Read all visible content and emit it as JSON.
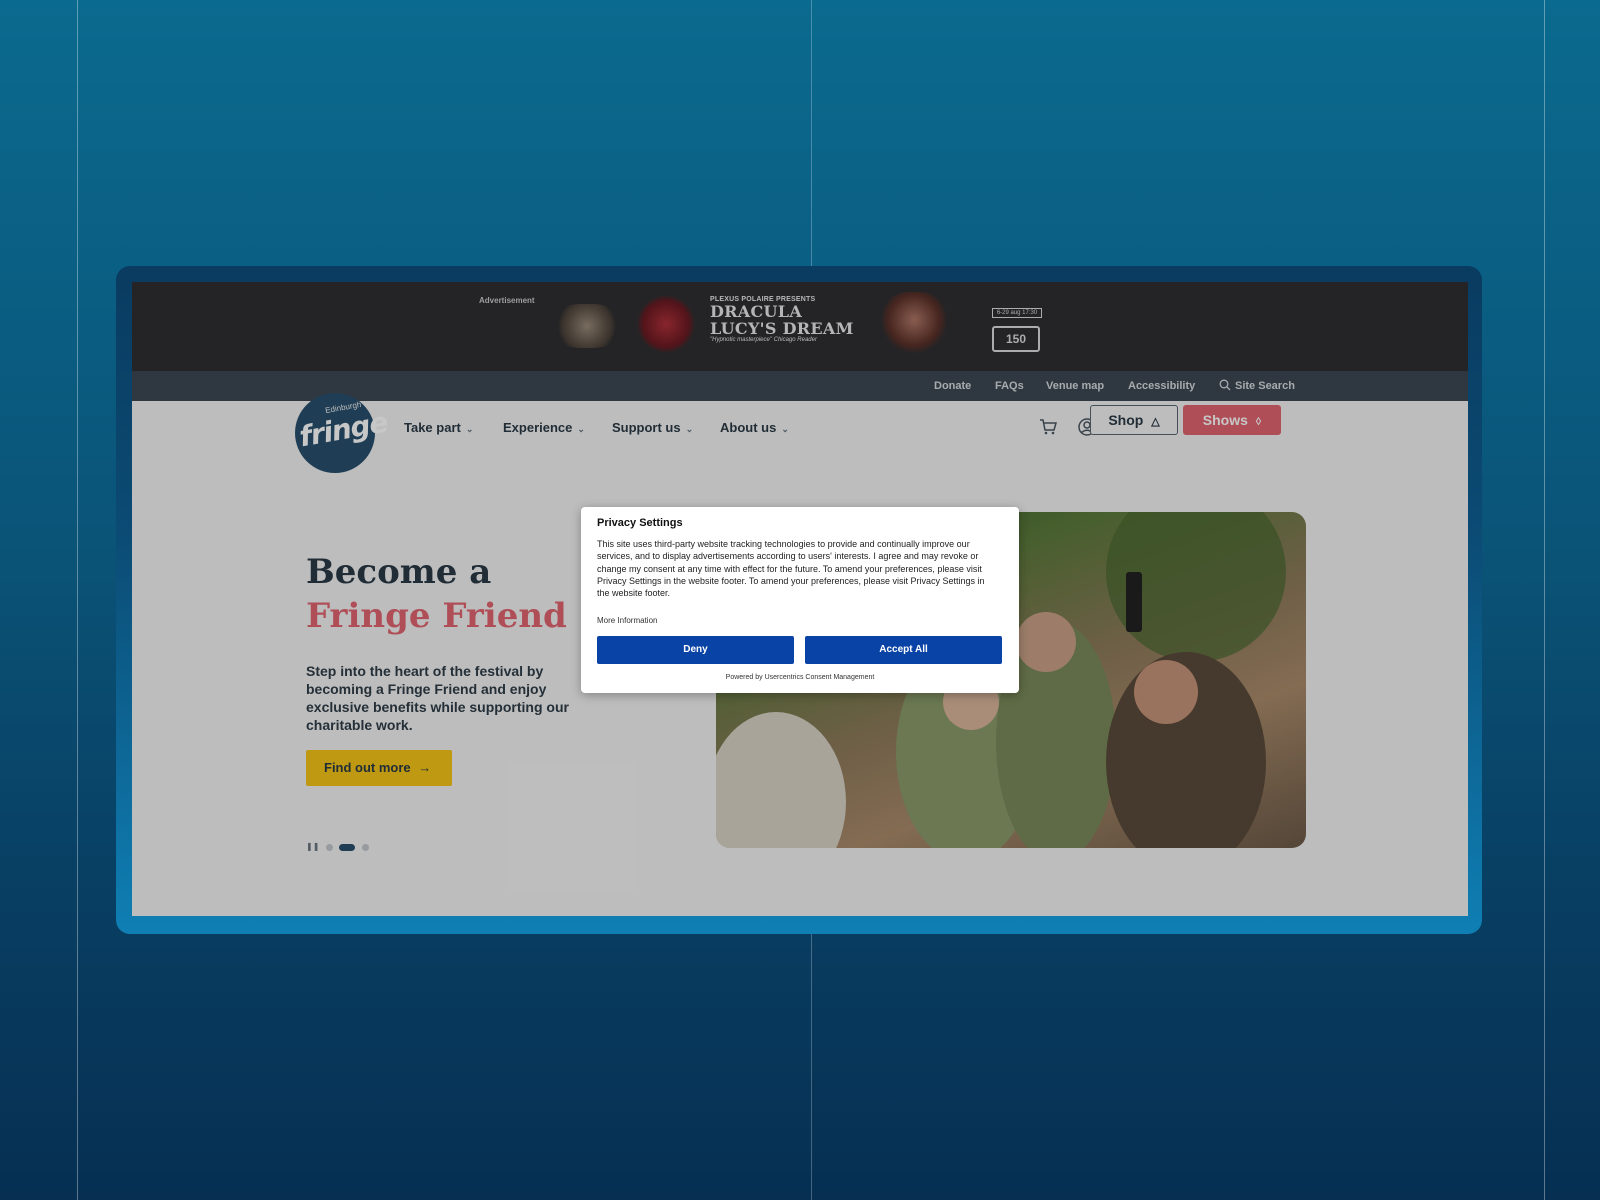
{
  "ad": {
    "label": "Advertisement",
    "presenter": "PLEXUS POLAIRE PRESENTS",
    "title_line1": "DRACULA",
    "title_line2": "LUCY'S DREAM",
    "quote": "\"Hypnotic masterpiece\" Chicago Reader",
    "dates": "6-29 aug 17:30",
    "badge": "150"
  },
  "utility_nav": [
    "Donate",
    "FAQs",
    "Venue map",
    "Accessibility",
    "Site Search"
  ],
  "logo": {
    "small": "Edinburgh",
    "big": "fringe"
  },
  "main_nav": [
    {
      "label": "Take part"
    },
    {
      "label": "Experience"
    },
    {
      "label": "Support us"
    },
    {
      "label": "About us"
    }
  ],
  "buttons": {
    "shop": "Shop",
    "shows": "Shows"
  },
  "hero": {
    "title_part1": "Become a ",
    "title_accent": "Fringe Friend",
    "description": "Step into the heart of the festival by becoming a Fringe Friend and enjoy exclusive benefits while supporting our charitable work.",
    "cta": "Find out more",
    "active_slide": 2,
    "total_slides": 3
  },
  "privacy": {
    "title": "Privacy Settings",
    "body": "This site uses third-party website tracking technologies to provide and continually improve our services, and to display advertisements according to users' interests. I agree and may revoke or change my consent at any time with effect for the future. To amend your preferences, please visit Privacy Settings in the website footer. To amend your preferences, please visit Privacy Settings in the website footer.",
    "more_info": "More Information",
    "deny": "Deny",
    "accept": "Accept All",
    "powered_by": "Powered by Usercentrics Consent Management"
  },
  "colors": {
    "brand_navy": "#28506e",
    "accent_pink": "#e06470",
    "cta_yellow": "#f5c518",
    "consent_blue": "#0a43a6"
  }
}
